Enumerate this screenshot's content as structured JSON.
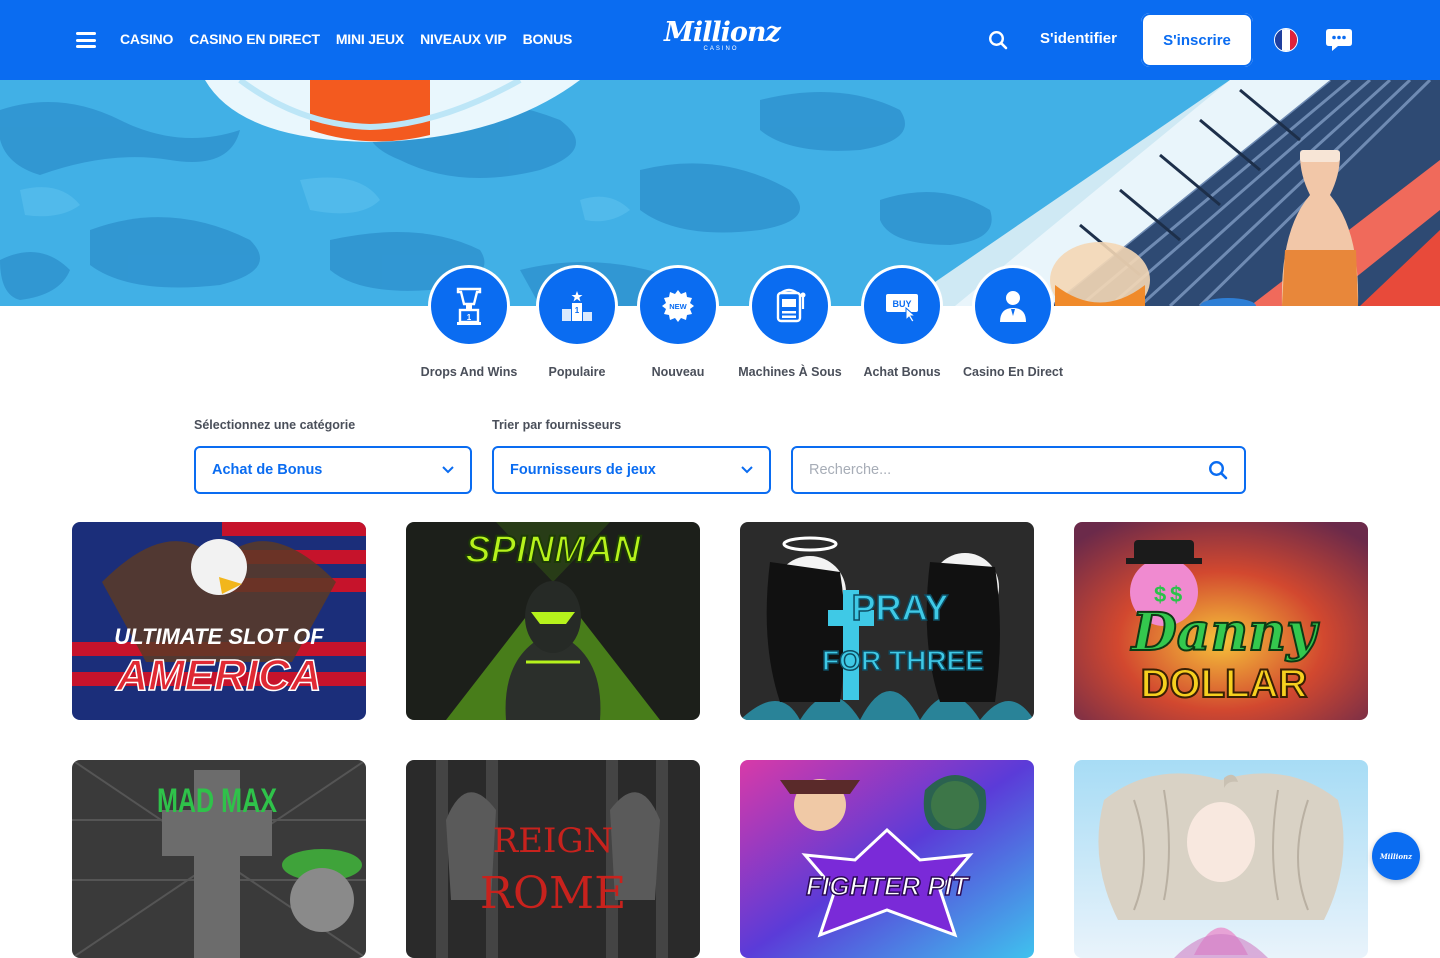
{
  "header": {
    "nav": [
      "CASINO",
      "CASINO EN DIRECT",
      "MINI JEUX",
      "NIVEAUX VIP",
      "BONUS"
    ],
    "logo_text": "Millionz",
    "logo_sub": "CASINO",
    "login_label": "S'identifier",
    "signup_label": "S'inscrire",
    "language_flag": "french-flag-icon",
    "colors": {
      "brand": "#0a6cf1"
    }
  },
  "categories": [
    {
      "label": "Drops And Wins",
      "icon": "trophy-icon"
    },
    {
      "label": "Populaire",
      "icon": "podium-icon"
    },
    {
      "label": "Nouveau",
      "icon": "new-badge-icon",
      "badge": "NEW"
    },
    {
      "label": "Machines À Sous",
      "icon": "slot-machine-icon"
    },
    {
      "label": "Achat Bonus",
      "icon": "buy-bonus-icon",
      "badge": "BUY"
    },
    {
      "label": "Casino En Direct",
      "icon": "live-dealer-icon"
    }
  ],
  "filters": {
    "category_label": "Sélectionnez une catégorie",
    "category_value": "Achat de Bonus",
    "provider_label": "Trier par fournisseurs",
    "provider_value": "Fournisseurs de jeux",
    "search_placeholder": "Recherche..."
  },
  "games": [
    {
      "title_line1": "ULTIMATE SLOT OF",
      "title_line2": "AMERICA"
    },
    {
      "title_line1": "SPINMAN",
      "title_line2": ""
    },
    {
      "title_line1": "PRAY",
      "title_line2": "FOR THREE"
    },
    {
      "title_line1": "Danny",
      "title_line2": "DOLLAR"
    },
    {
      "title_line1": "MAD MAX",
      "title_line2": ""
    },
    {
      "title_line1": "REIGN",
      "title_line2": "ROME"
    },
    {
      "title_line1": "FIGHTER PIT",
      "title_line2": ""
    },
    {
      "title_line1": "",
      "title_line2": ""
    }
  ],
  "support_button": "Millionz"
}
